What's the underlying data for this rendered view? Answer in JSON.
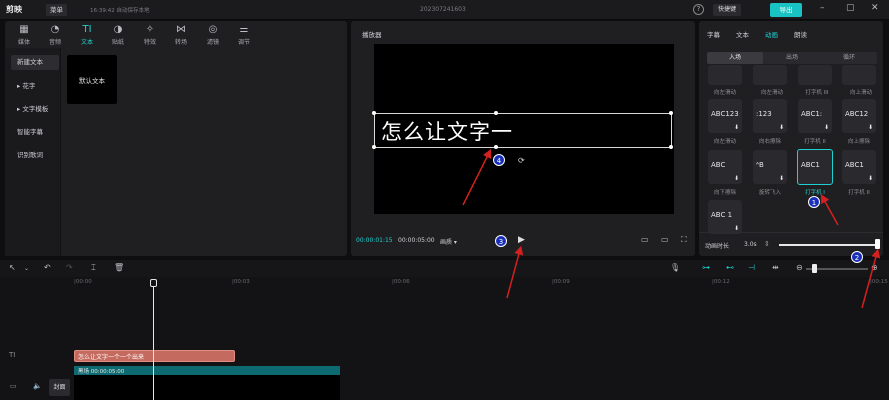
{
  "titlebar": {
    "logo": "剪映",
    "menu": "菜单",
    "autosave": "16:39:42 自动保存本地",
    "project": "202307241603",
    "help": "?",
    "shortcut": "快捷键",
    "export": "导出"
  },
  "tools": [
    {
      "label": "媒体",
      "icon": "media-icon",
      "glyph": "▦"
    },
    {
      "label": "音频",
      "icon": "audio-icon",
      "glyph": "◔"
    },
    {
      "label": "文本",
      "icon": "text-icon",
      "glyph": "TI"
    },
    {
      "label": "贴纸",
      "icon": "sticker-icon",
      "glyph": "◑"
    },
    {
      "label": "特效",
      "icon": "effects-icon",
      "glyph": "✧"
    },
    {
      "label": "转场",
      "icon": "transition-icon",
      "glyph": "⋈"
    },
    {
      "label": "滤镜",
      "icon": "filter-icon",
      "glyph": "◎"
    },
    {
      "label": "调节",
      "icon": "adjust-icon",
      "glyph": "⚌"
    }
  ],
  "sidebar": {
    "items": [
      {
        "label": "新建文本"
      },
      {
        "label": "▸ 花字"
      },
      {
        "label": "▸ 文字模板"
      },
      {
        "label": "智能字幕"
      },
      {
        "label": "识别歌词"
      }
    ]
  },
  "default_text_card": "默认文本",
  "player": {
    "title": "播放器",
    "canvas_text": "怎么让文字一",
    "timecode_current": "00:00:01:15",
    "timecode_total": "00:00:05:00",
    "quality": "画质 ▾"
  },
  "right_panel": {
    "tabs": [
      "字幕",
      "文本",
      "动画",
      "朗读"
    ],
    "subtabs": [
      "入场",
      "出场",
      "循环"
    ],
    "row_labels_top": [
      "向左滑动",
      "向左滑动",
      "打字机 III",
      "向上滑动"
    ],
    "row2": [
      {
        "text": "ABC123",
        "dl": "⬇"
      },
      {
        "text": ":123",
        "dl": "⬇"
      },
      {
        "text": "ABC1:",
        "dl": "⬇"
      },
      {
        "text": "ABC12",
        "dl": "⬇"
      }
    ],
    "row2_labels": [
      "向左滑动",
      "向右擦除",
      "打字机 II",
      "向上擦除"
    ],
    "row3": [
      {
        "text": "ABC",
        "dl": "⬇"
      },
      {
        "text": "ᴬB",
        "dl": "⬇"
      },
      {
        "text": "ABC1",
        "dl": ""
      },
      {
        "text": "ABC1",
        "dl": "⬇"
      }
    ],
    "row3_labels": [
      "向下擦除",
      "旋转飞入",
      "打字机 I",
      "打字机 II"
    ],
    "row4": [
      {
        "text": "ABC 1",
        "dl": "⬇"
      }
    ],
    "duration_label": "动画时长",
    "duration_value": "3.0s",
    "duration_fraction": 1.0
  },
  "timeline": {
    "ticks": [
      "|00:00",
      "|00:03",
      "|00:06",
      "|00:09",
      "|00:12",
      "|00:15"
    ],
    "text_track_label": "TI",
    "text_clip": "怎么让文字一个一个出来",
    "video_clip": "黑场 00:00:05:00",
    "cover": "封面"
  },
  "annotations": {
    "markers": [
      "1",
      "2",
      "3",
      "4"
    ],
    "color_arrow": "#d42020",
    "color_marker": "#1a2fb8"
  },
  "colors": {
    "accent": "#1fd0d0",
    "panel": "#1f1f22",
    "background": "#0e0e10",
    "text_clip": "#c56a5f"
  }
}
